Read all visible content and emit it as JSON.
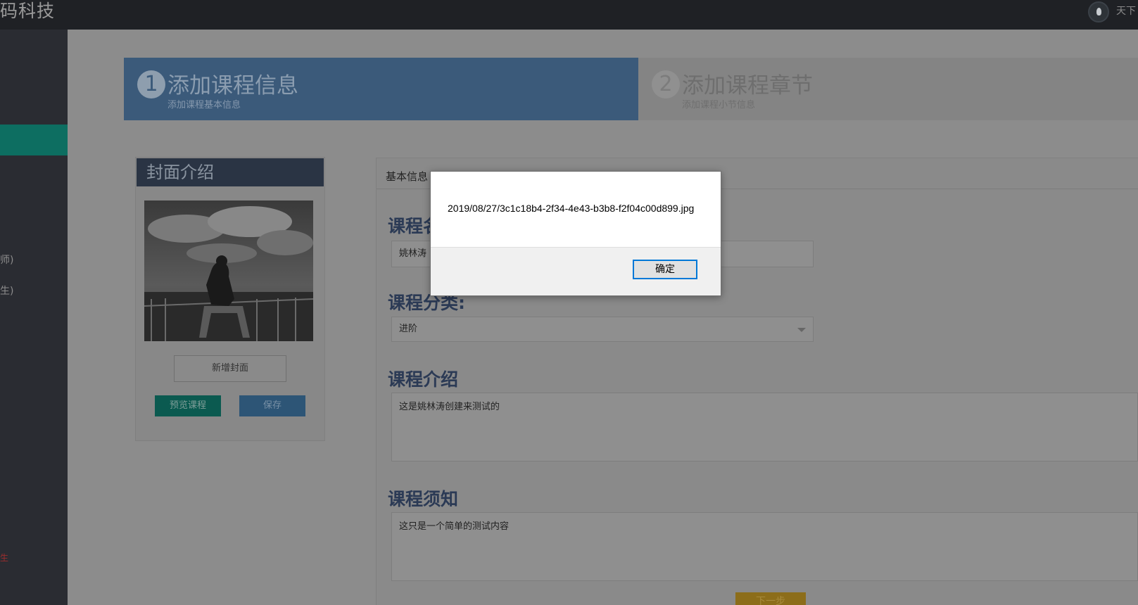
{
  "header": {
    "brand": "码科技",
    "user_name": "天下"
  },
  "sidebar": {
    "items": [
      {
        "label": "师)"
      },
      {
        "label": "生)"
      },
      {
        "label": "生"
      }
    ]
  },
  "steps": [
    {
      "number": "1",
      "title": "添加课程信息",
      "subtitle": "添加课程基本信息",
      "active": true
    },
    {
      "number": "2",
      "title": "添加课程章节",
      "subtitle": "添加课程小节信息",
      "active": false
    }
  ],
  "cover": {
    "title": "封面介绍",
    "add_cover_label": "新增封面",
    "preview_label": "预览课程",
    "save_label": "保存"
  },
  "form": {
    "panel_title": "基本信息",
    "course_name_label": "课程名称:",
    "course_name_value": "姚林涛",
    "category_label": "课程分类:",
    "category_value": "进阶",
    "intro_label": "课程介绍",
    "intro_value": "这是姚林涛创建来测试的",
    "notice_label": "课程须知",
    "notice_value": "这只是一个简单的测试内容",
    "next_label": "下一步"
  },
  "dialog": {
    "message": "2019/08/27/3c1c18b4-2f34-4e43-b3b8-f2f04c00d899.jpg",
    "ok_label": "确定"
  },
  "colors": {
    "topbar": "#1f2125",
    "sidebar": "#2a2c32",
    "sidebar_active": "#0d6e61",
    "step_active": "#3b5a7a",
    "overlay_gray": "#8c8c8c",
    "dialog_button_border": "#0078d7"
  }
}
